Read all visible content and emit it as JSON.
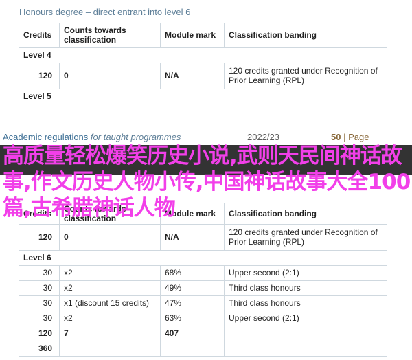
{
  "top": {
    "title": "Honours degree – direct entrant into level 6",
    "headers": [
      "Credits",
      "Counts towards classification",
      "Module mark",
      "Classification banding"
    ],
    "level4": "Level 4",
    "row1": {
      "credits": "120",
      "counts": "0",
      "mark": "N/A",
      "banding": "120 credits granted under Recognition of Prior Learning (RPL)"
    },
    "level5": "Level 5"
  },
  "footer": {
    "doc": "Academic regulations",
    "doc_italic": "for taught programmes",
    "year": "2022/23",
    "page_num": "50",
    "page_word": "| Page"
  },
  "overlay_text": "高质量轻松爆笑历史小说,武则天民间神话故事,作文历史人物小传,中国神话故事大全100篇,古希腊神话人物",
  "bottom": {
    "headers": [
      "Credits",
      "Counts towards classification",
      "Module mark",
      "Classification banding"
    ],
    "row1": {
      "credits": "120",
      "counts": "0",
      "mark": "N/A",
      "banding": "120 credits granted under Recognition of Prior Learning (RPL)"
    },
    "level6": "Level 6",
    "rows": [
      {
        "credits": "30",
        "counts": "x2",
        "mark": "68%",
        "banding": "Upper second (2:1)"
      },
      {
        "credits": "30",
        "counts": "x2",
        "mark": "49%",
        "banding": "Third class honours"
      },
      {
        "credits": "30",
        "counts": "x1 (discount 15 credits)",
        "mark": "47%",
        "banding": "Third class honours"
      },
      {
        "credits": "30",
        "counts": "x2",
        "mark": "63%",
        "banding": "Upper second (2:1)"
      }
    ],
    "total": {
      "credits": "120",
      "counts": "7",
      "mark": "407"
    },
    "grand": {
      "credits": "360"
    }
  }
}
